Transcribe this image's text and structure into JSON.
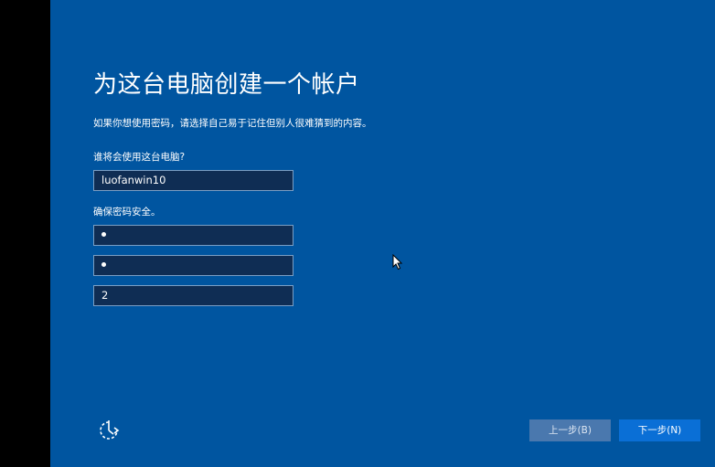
{
  "page": {
    "title": "为这台电脑创建一个帐户",
    "subtitle": "如果你想使用密码，请选择自己易于记住但别人很难猜到的内容。"
  },
  "form": {
    "username_label": "谁将会使用这台电脑?",
    "username_value": "luofanwin10",
    "password_label": "确保密码安全。",
    "password_dots": 1,
    "confirm_dots": 1,
    "hint_value": "2"
  },
  "footer": {
    "ease_of_access_icon": "ease-of-access-icon",
    "back_label": "上一步(B)",
    "next_label": "下一步(N)"
  },
  "colors": {
    "background": "#0055a0",
    "field_background": "#0f2d54",
    "next_button": "#0a6fd6",
    "back_button": "#4a78ae"
  }
}
